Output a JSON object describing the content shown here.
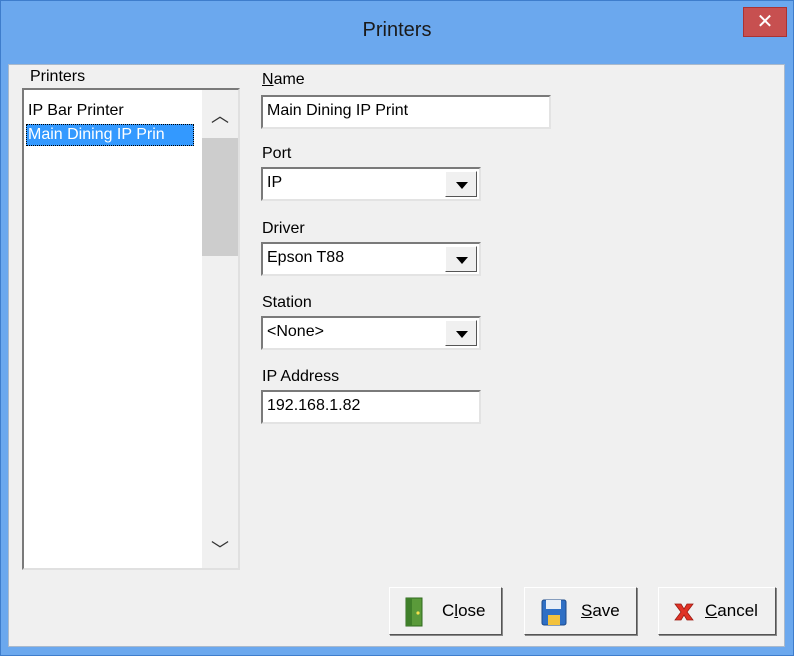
{
  "window": {
    "title": "Printers",
    "close_glyph": "✕"
  },
  "list": {
    "label": "Printers",
    "items": [
      {
        "label": "IP Bar Printer",
        "selected": false
      },
      {
        "label": "Main Dining IP Prin",
        "selected": true
      }
    ],
    "scroll_up_glyph": "︿",
    "scroll_down_glyph": "﹀"
  },
  "form": {
    "name": {
      "label_first": "N",
      "label_rest": "ame",
      "value": "Main Dining IP Print"
    },
    "port": {
      "label": "Port",
      "value": "IP"
    },
    "driver": {
      "label": "Driver",
      "value": "Epson T88"
    },
    "station": {
      "label": "Station",
      "value": "<None>"
    },
    "ip_address": {
      "label": "IP Address",
      "value": "192.168.1.82"
    }
  },
  "buttons": {
    "close": {
      "pre": "C",
      "accel": "l",
      "post": "ose",
      "icon": "door-icon"
    },
    "save": {
      "accel": "S",
      "post": "ave",
      "icon": "floppy-disk-icon"
    },
    "cancel": {
      "accel": "C",
      "post": "ancel",
      "icon": "red-x-icon"
    }
  },
  "colors": {
    "title_bar": "#6ba8ee",
    "close_button": "#c75050",
    "selection": "#3399ff"
  }
}
